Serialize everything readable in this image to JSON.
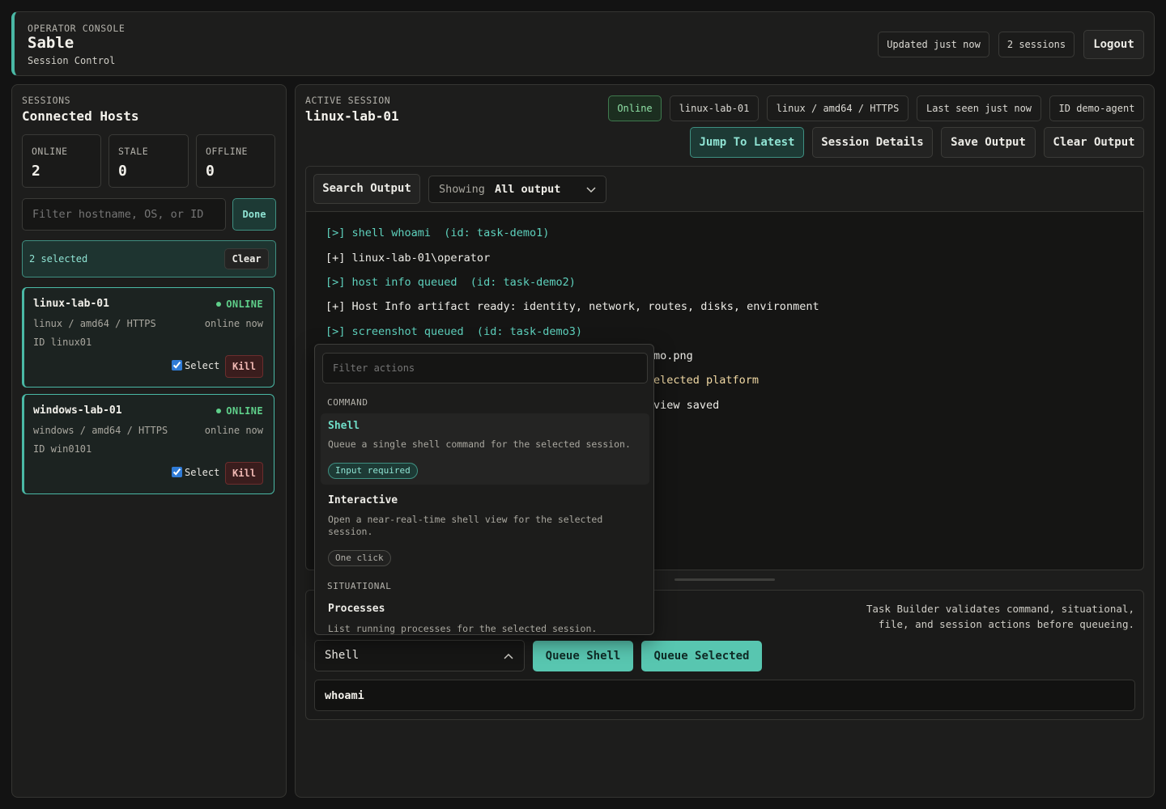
{
  "header": {
    "eyebrow": "OPERATOR CONSOLE",
    "app_name": "Sable",
    "subtitle": "Session Control",
    "updated": "Updated just now",
    "sessions": "2 sessions",
    "logout": "Logout"
  },
  "sidebar": {
    "eyebrow": "SESSIONS",
    "title": "Connected Hosts",
    "stats": [
      {
        "label": "ONLINE",
        "value": "2"
      },
      {
        "label": "STALE",
        "value": "0"
      },
      {
        "label": "OFFLINE",
        "value": "0"
      }
    ],
    "filter_placeholder": "Filter hostname, OS, or ID",
    "done": "Done",
    "selected_text": "2 selected",
    "clear": "Clear",
    "hosts": [
      {
        "name": "linux-lab-01",
        "status": "ONLINE",
        "meta": "linux / amd64 / HTTPS",
        "seen": "online now",
        "id": "ID linux01",
        "select": "Select",
        "kill": "Kill"
      },
      {
        "name": "windows-lab-01",
        "status": "ONLINE",
        "meta": "windows / amd64 / HTTPS",
        "seen": "online now",
        "id": "ID win0101",
        "select": "Select",
        "kill": "Kill"
      }
    ]
  },
  "session": {
    "eyebrow": "ACTIVE SESSION",
    "title": "linux-lab-01",
    "badges": [
      "Online",
      "linux-lab-01",
      "linux / amd64 / HTTPS",
      "Last seen just now",
      "ID demo-agent"
    ],
    "actions": [
      "Jump To Latest",
      "Session Details",
      "Save Output",
      "Clear Output"
    ]
  },
  "output": {
    "search": "Search Output",
    "showing_prefix": "Showing",
    "showing_value": "All output",
    "lines": [
      "[>] shell whoami  (id: task-demo1)",
      "[+] linux-lab-01\\operator",
      "[>] host info queued  (id: task-demo2)",
      "[+] Host Info artifact ready: identity, network, routes, disks, environment",
      "[>] screenshot queued  (id: task-demo3)",
      "mo.png",
      "elected platform",
      "view saved"
    ]
  },
  "action_menu": {
    "filter_placeholder": "Filter actions",
    "groups": [
      {
        "label": "COMMAND",
        "items": [
          {
            "title": "Shell",
            "desc": "Queue a single shell command for the selected session.",
            "tag": "Input required"
          },
          {
            "title": "Interactive",
            "desc": "Open a near-real-time shell view for the selected session.",
            "tag": "One click"
          }
        ]
      },
      {
        "label": "SITUATIONAL",
        "items": [
          {
            "title": "Processes",
            "desc": "List running processes for the selected session."
          }
        ]
      }
    ]
  },
  "task_builder": {
    "note_line1": "Task Builder validates command, situational,",
    "note_line2": "file, and session actions before queueing.",
    "selected_action": "Shell",
    "queue_shell": "Queue Shell",
    "queue_selected": "Queue Selected",
    "command_value": "whoami"
  },
  "colors": {
    "accent": "#4ab8a5",
    "online": "#5fcf8a",
    "danger": "#3a1d1d"
  }
}
